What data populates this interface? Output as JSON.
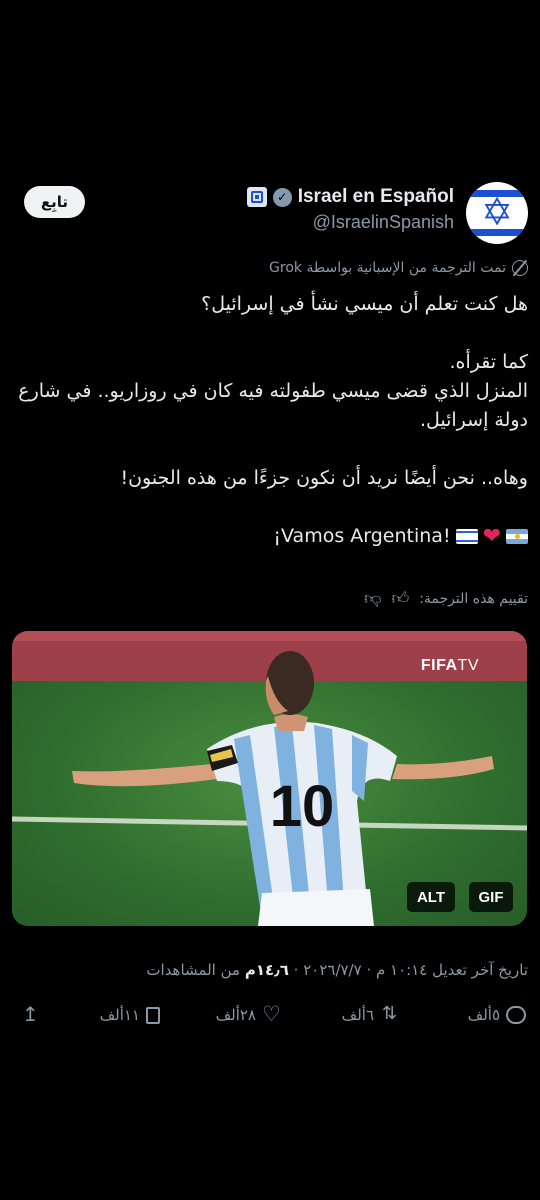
{
  "account": {
    "display_name": "Israel en Español",
    "handle": "@IsraelinSpanish",
    "follow_label": "تابِع"
  },
  "translation": {
    "label": "تمت الترجمة من الإسبانية بواسطة Grok",
    "rate_label": "تقييم هذه الترجمة:"
  },
  "post": {
    "line1": "هل كنت تعلم أن ميسي نشأ في إسرائيل؟",
    "line2": "كما تقرأه.",
    "line3": "المنزل الذي قضى ميسي طفولته فيه كان في روزاريو.. في شارع دولة إسرائيل.",
    "line4": "وهاه.. نحن أيضًا نريد أن نكون جزءًا من هذه الجنون!",
    "line5": "¡Vamos Argentina!"
  },
  "media": {
    "watermark": "FIFA",
    "watermark_suffix": "TV",
    "jersey_number": "10",
    "alt_badge": "ALT",
    "gif_badge": "GIF"
  },
  "meta": {
    "timestamp": "تاريخ آخر تعديل ١٠:١٤ م · ٢٠٢٦/٧/٧ · ",
    "views_count": "١٤٫٦م",
    "views_label": " من المشاهدات"
  },
  "actions": {
    "replies": "٥ألف",
    "retweets": "٦ألف",
    "likes": "٢٨ألف",
    "bookmarks": "١١ألف"
  },
  "colors": {
    "background": "#000000",
    "text": "#e7e9ea",
    "secondary": "#8b98a5",
    "israel_blue": "#1c4fd1",
    "heart": "#e0245e"
  }
}
